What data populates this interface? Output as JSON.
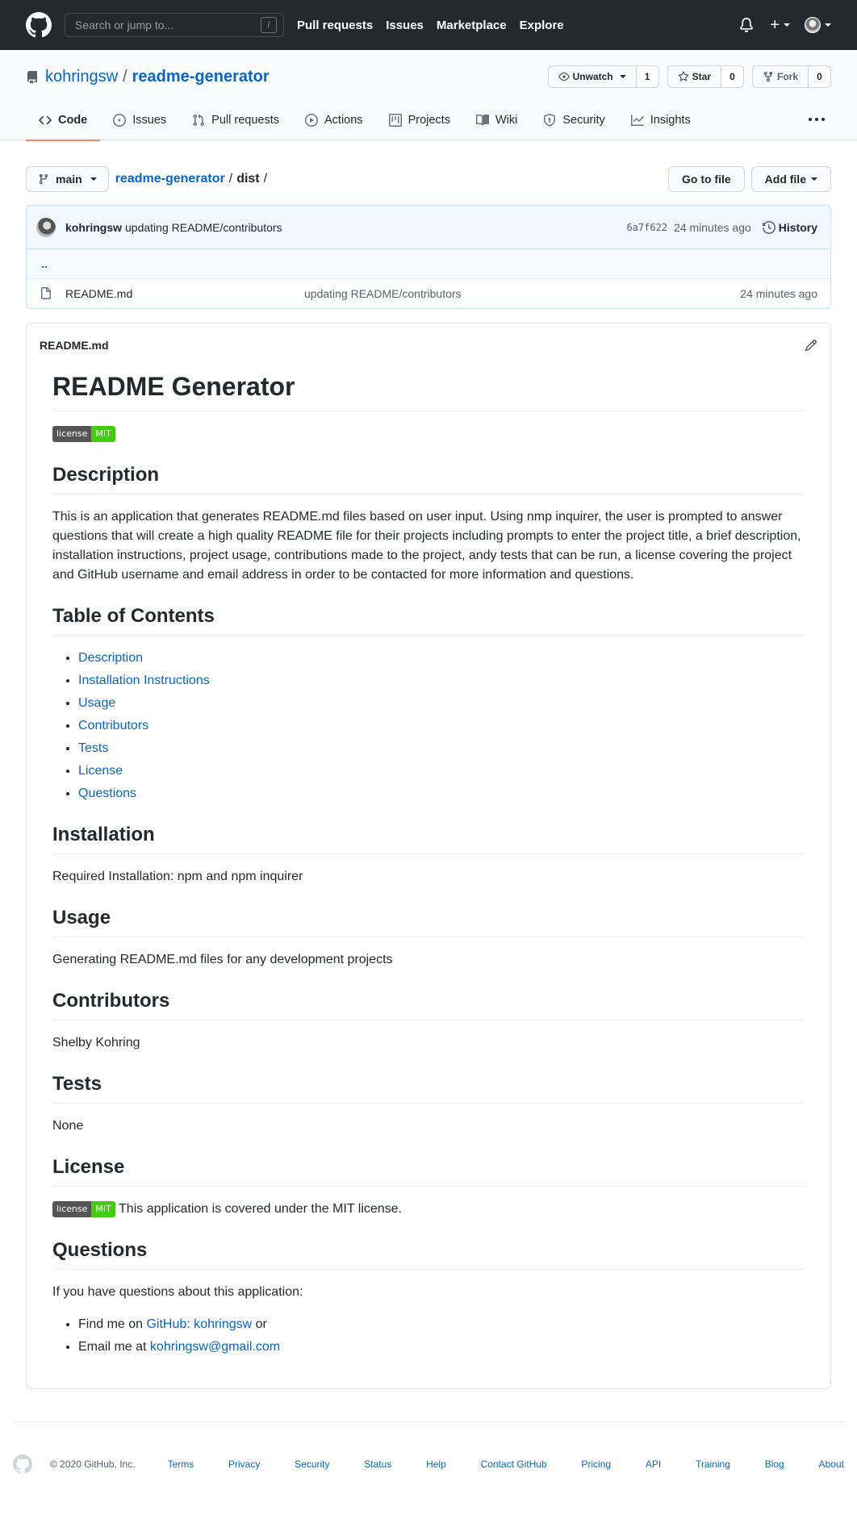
{
  "header": {
    "search_placeholder": "Search or jump to...",
    "search_shortcut": "/",
    "nav": [
      "Pull requests",
      "Issues",
      "Marketplace",
      "Explore"
    ],
    "plus": "+"
  },
  "repo": {
    "owner": "kohringsw",
    "separator": "/",
    "name": "readme-generator",
    "unwatch_label": "Unwatch",
    "watch_count": "1",
    "star_label": "Star",
    "star_count": "0",
    "fork_label": "Fork",
    "fork_count": "0"
  },
  "tabs": [
    {
      "label": "Code",
      "icon": "code-icon"
    },
    {
      "label": "Issues",
      "icon": "issue-icon"
    },
    {
      "label": "Pull requests",
      "icon": "pull-request-icon"
    },
    {
      "label": "Actions",
      "icon": "play-icon"
    },
    {
      "label": "Projects",
      "icon": "project-icon"
    },
    {
      "label": "Wiki",
      "icon": "book-icon"
    },
    {
      "label": "Security",
      "icon": "shield-icon"
    },
    {
      "label": "Insights",
      "icon": "graph-icon"
    }
  ],
  "filenav": {
    "branch": "main",
    "crumb_root": "readme-generator",
    "crumb_sep": "/",
    "crumb_dir": "dist",
    "crumb_trail": "/",
    "go_to_file": "Go to file",
    "add_file": "Add file"
  },
  "commit": {
    "author": "kohringsw",
    "message": "updating README/contributors",
    "sha": "6a7f622",
    "age": "24 minutes ago",
    "history": "History"
  },
  "files": {
    "updir": "..",
    "rows": [
      {
        "name": "README.md",
        "message": "updating README/contributors",
        "age": "24 minutes ago"
      }
    ]
  },
  "readme": {
    "filename": "README.md",
    "title": "README Generator",
    "badge_left": "license",
    "badge_right": "MIT",
    "h_description": "Description",
    "description": "This is an application that generates README.md files based on user input. Using nmp inquirer, the user is prompted to answer questions that will create a high quality README file for their projects including prompts to enter the project title, a brief description, installation instructions, project usage, contributions made to the project, andy tests that can be run, a license covering the project and GitHub username and email address in order to be contacted for more information and questions.",
    "h_toc": "Table of Contents",
    "toc": [
      "Description",
      "Installation Instructions",
      "Usage",
      "Contributors",
      "Tests",
      "License",
      "Questions"
    ],
    "h_installation": "Installation",
    "installation": "Required Installation: npm and npm inquirer",
    "h_usage": "Usage",
    "usage": "Generating README.md files for any development projects",
    "h_contributors": "Contributors",
    "contributors": "Shelby Kohring",
    "h_tests": "Tests",
    "tests": "None",
    "h_license": "License",
    "license": " This application is covered under the MIT license.",
    "h_questions": "Questions",
    "questions_intro": "If you have questions about this application:",
    "q1_prefix": "Find me on ",
    "q1_link": "GitHub: kohringsw",
    "q1_suffix": " or",
    "q2_prefix": "Email me at ",
    "q2_link": "kohringsw@gmail.com"
  },
  "footer": {
    "copyright": "© 2020 GitHub, Inc.",
    "links": [
      "Terms",
      "Privacy",
      "Security",
      "Status",
      "Help",
      "Contact GitHub",
      "Pricing",
      "API",
      "Training",
      "Blog",
      "About"
    ]
  },
  "colors": {
    "header_bg": "#24292e",
    "link": "#0366d6",
    "active_tab_underline": "#f9826c",
    "commit_bg": "#f1f8ff",
    "badge_green": "#4c1"
  }
}
